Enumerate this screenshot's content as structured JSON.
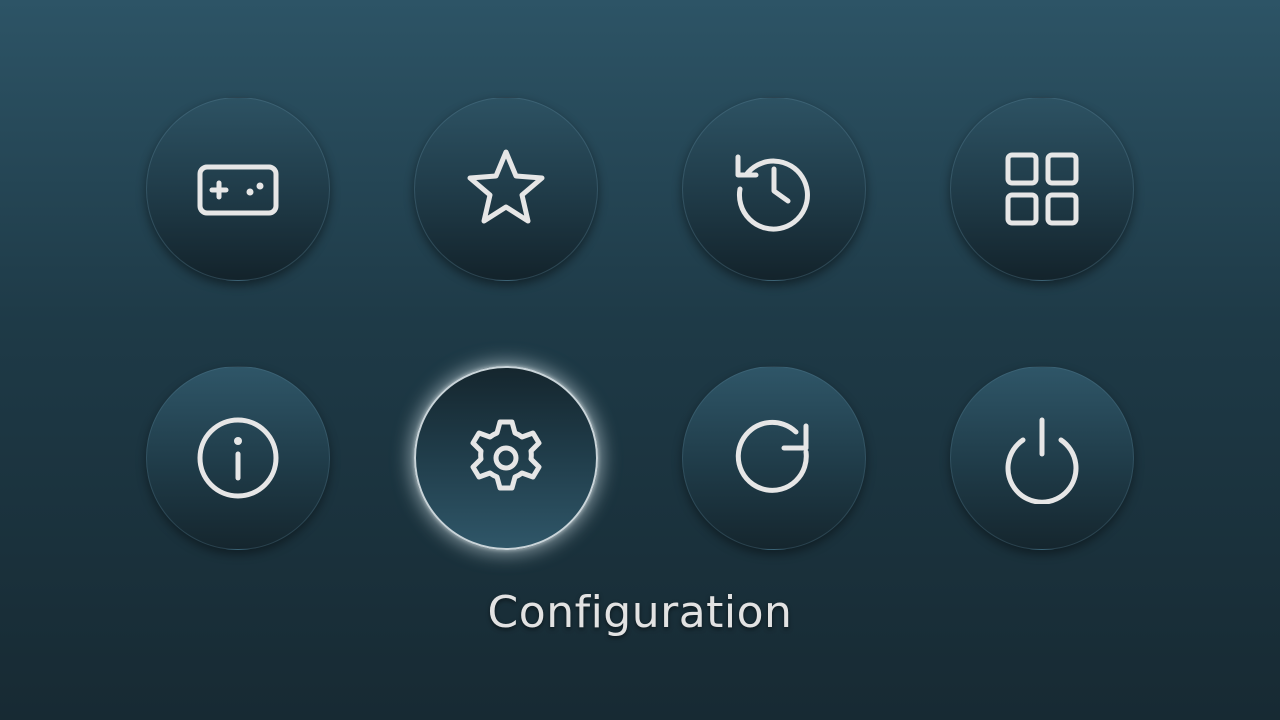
{
  "menu": {
    "items": [
      {
        "id": "games",
        "icon": "gamepad-icon",
        "selected": false
      },
      {
        "id": "favorites",
        "icon": "star-icon",
        "selected": false
      },
      {
        "id": "history",
        "icon": "history-icon",
        "selected": false
      },
      {
        "id": "apps",
        "icon": "grid-icon",
        "selected": false
      },
      {
        "id": "info",
        "icon": "info-icon",
        "selected": false
      },
      {
        "id": "configuration",
        "icon": "gear-icon",
        "selected": true
      },
      {
        "id": "refresh",
        "icon": "refresh-icon",
        "selected": false
      },
      {
        "id": "power",
        "icon": "power-icon",
        "selected": false
      }
    ],
    "selected_label": "Configuration"
  },
  "colors": {
    "background_top": "#2d5466",
    "background_bottom": "#172a33",
    "icon": "#e6e6e6",
    "selection_glow": "#dcebf0"
  }
}
